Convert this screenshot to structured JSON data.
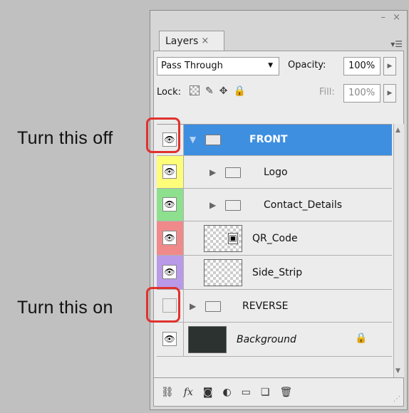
{
  "annotations": {
    "turn_off": "Turn this off",
    "turn_on": "Turn this on"
  },
  "panel": {
    "window_controls": "– ×",
    "tab_label": "Layers",
    "tab_close": "×",
    "panel_menu": "▾☰"
  },
  "blend": {
    "mode": "Pass Through",
    "opacity_label": "Opacity:",
    "opacity_value": "100%"
  },
  "lock": {
    "label": "Lock:",
    "fill_label": "Fill:",
    "fill_value": "100%"
  },
  "layers": [
    {
      "name": "FRONT",
      "kind": "group",
      "expanded": true,
      "selected": true,
      "visible": true,
      "color": "none"
    },
    {
      "name": "Logo",
      "kind": "group",
      "expanded": false,
      "visible": true,
      "color": "#fdfd7a"
    },
    {
      "name": "Contact_Details",
      "kind": "group",
      "expanded": false,
      "visible": true,
      "color": "#8de08d"
    },
    {
      "name": "QR_Code",
      "kind": "smart-object",
      "visible": true,
      "color": "#f08a8a"
    },
    {
      "name": "Side_Strip",
      "kind": "raster",
      "visible": true,
      "color": "#b99ae8"
    },
    {
      "name": "REVERSE",
      "kind": "group",
      "expanded": false,
      "visible": false,
      "color": "none"
    },
    {
      "name": "Background",
      "kind": "background",
      "visible": true,
      "locked": true,
      "color": "none"
    }
  ],
  "colors": {
    "selection": "#3e8fe0",
    "highlight_ring": "#e0322e"
  },
  "icons": {
    "visibility": "eye-icon",
    "group": "folder-icon",
    "lock": "lock-icon",
    "link": "link-icon",
    "fx": "fx-icon",
    "mask": "mask-icon",
    "adjustment": "adjustment-icon",
    "new_group": "new-group-icon",
    "new_layer": "new-layer-icon",
    "delete": "trash-icon"
  }
}
